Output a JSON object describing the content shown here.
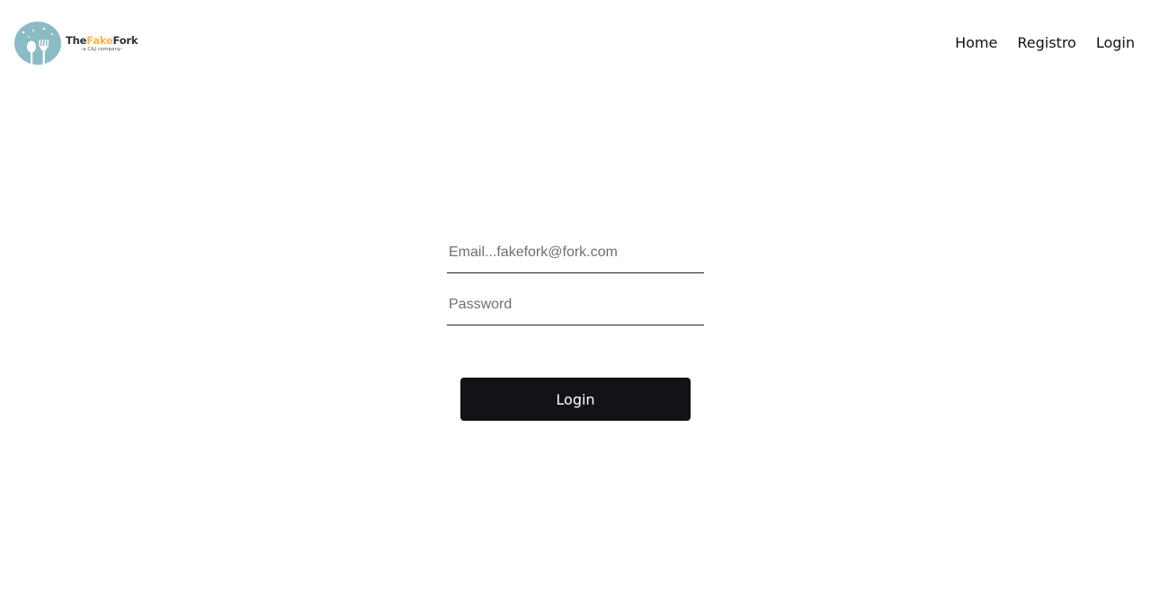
{
  "brand": {
    "name_part1": "The",
    "name_part2": "Fake",
    "name_part3": "Fork",
    "tagline": "-a C&J company-",
    "logo_icon": "spoon-fork-icon",
    "colors": {
      "circle": "#8bbcc6",
      "accent": "#f2b64a",
      "dark": "#2e3236"
    }
  },
  "nav": {
    "items": [
      {
        "label": "Home"
      },
      {
        "label": "Registro"
      },
      {
        "label": "Login"
      }
    ]
  },
  "form": {
    "email": {
      "placeholder": "Email...fakefork@fork.com",
      "value": ""
    },
    "password": {
      "placeholder": "Password",
      "value": ""
    },
    "submit_label": "Login",
    "button_color": "#121317"
  }
}
